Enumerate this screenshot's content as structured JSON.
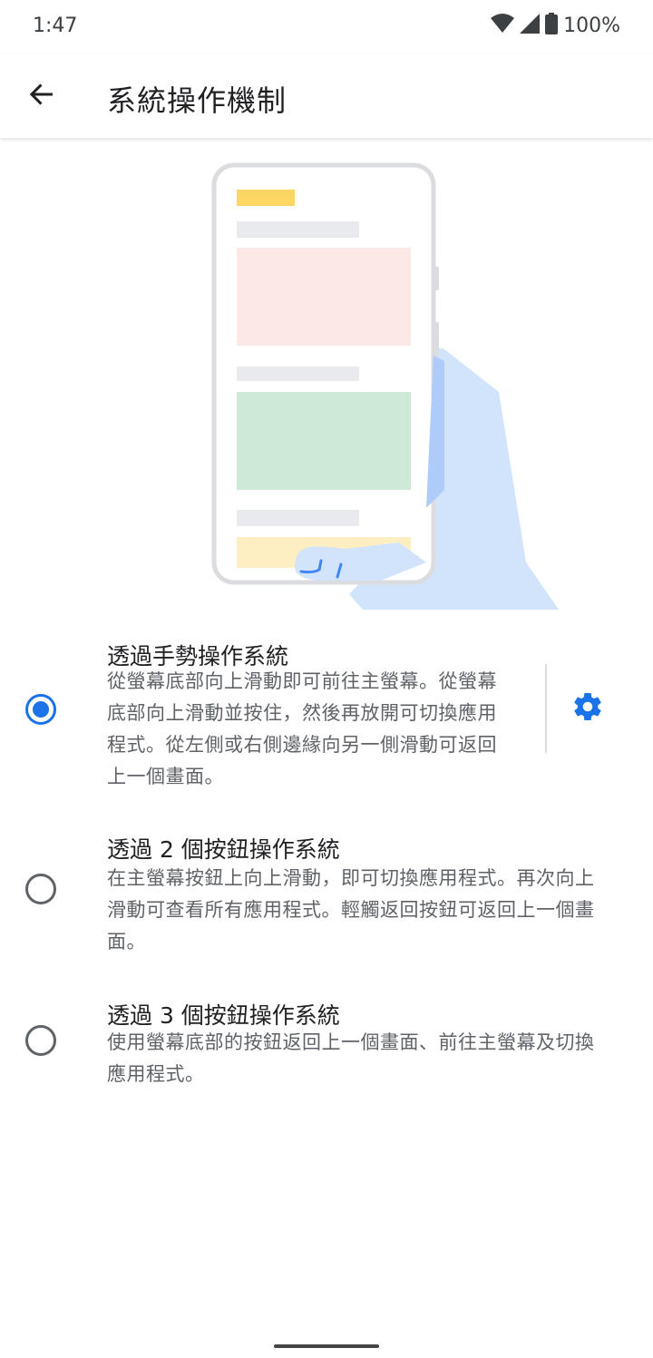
{
  "status_bar": {
    "time": "1:47",
    "battery": "100%",
    "icons": [
      "wifi-icon",
      "cell-signal-icon",
      "battery-icon"
    ]
  },
  "app_bar": {
    "title": "系統操作機制",
    "back_icon": "arrow-back-icon"
  },
  "options": [
    {
      "title": "透過手勢操作系統",
      "description_lines": [
        "從螢幕底部向上滑動即可前往主螢幕。從螢幕",
        "底部向上滑動並按住，然後再放開可切換應用",
        "程式。從左側或右側邊緣向另一側滑動可返回",
        "上一個畫面。"
      ],
      "selected": true,
      "settings_icon": "gear-icon"
    },
    {
      "title": "透過 2 個按鈕操作系統",
      "description_lines": [
        "在主螢幕按鈕上向上滑動，即可切換應用程式。再次向上",
        "滑動可查看所有應用程式。輕觸返回按鈕可返回上一個畫",
        "面。"
      ],
      "selected": false
    },
    {
      "title": "透過 3 個按鈕操作系統",
      "description_lines": [
        "使用螢幕底部的按鈕返回上一個畫面、前往主螢幕及切換",
        "應用程式。"
      ],
      "selected": false
    }
  ],
  "colors": {
    "accent": "#1a73e8",
    "hand": "#d2e3fc",
    "card_red": "#fce8e6",
    "card_green": "#ceead6",
    "card_yellow": "#feefc3",
    "title_bar_yellow": "#fdd663"
  }
}
